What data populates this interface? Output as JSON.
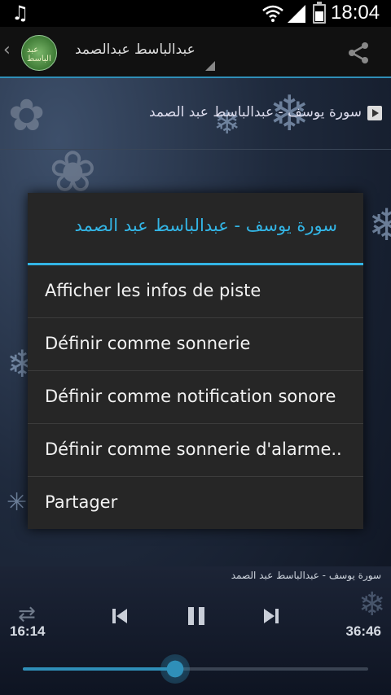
{
  "status_bar": {
    "time": "18:04",
    "icons": [
      "music-note-icon",
      "wifi-icon",
      "signal-icon",
      "battery-icon"
    ]
  },
  "action_bar": {
    "title": "عبدالباسط عبدالصمد",
    "logo_text": "عبد الباسط"
  },
  "now_playing": {
    "title": "سورة يوسف - عبدالباسط عبد الصمد"
  },
  "dialog": {
    "title": "سورة يوسف - عبدالباسط عبد الصمد",
    "items": [
      {
        "label": "Afficher les infos de piste"
      },
      {
        "label": "Définir comme sonnerie"
      },
      {
        "label": "Définir comme notification sonore"
      },
      {
        "label": "Définir comme sonnerie d'alarme.."
      },
      {
        "label": "Partager"
      }
    ]
  },
  "player": {
    "track_title": "سورة يوسف - عبدالباسط عبد الصمد",
    "elapsed": "16:14",
    "duration": "36:46",
    "progress": 0.44
  },
  "colors": {
    "accent": "#33b5e5",
    "dialog_bg": "#262626",
    "status_bg": "#000000"
  }
}
